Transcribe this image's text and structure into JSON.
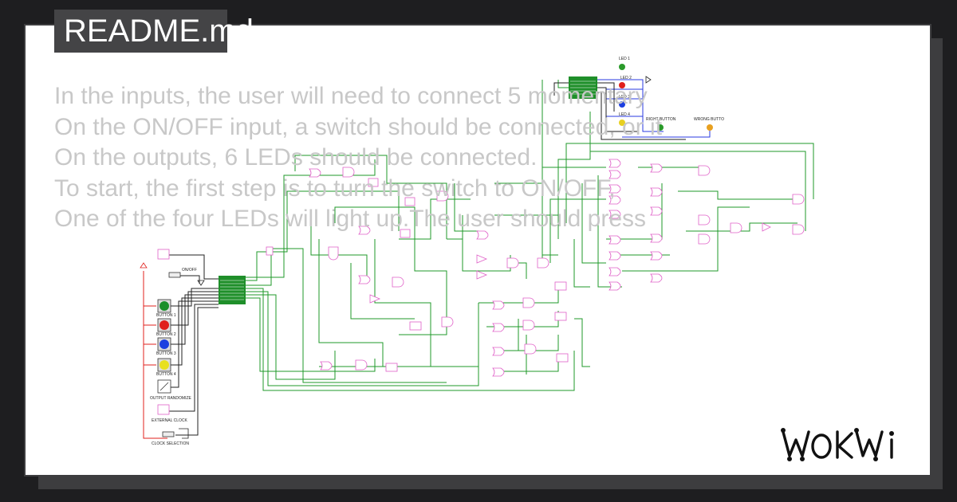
{
  "file_tab": {
    "title": "README.md"
  },
  "description": {
    "lines": [
      "In the inputs, the user will need to connect 5 momentary",
      "On the ON/OFF input, a switch should be connected, or it",
      "On the outputs, 6 LEDs should be connected.",
      "To start, the first step is to turn the switch to ON/OFF,",
      "One of the four LEDs will light up.The user should press"
    ]
  },
  "inputs": {
    "onoff_label": "ON/OFF",
    "buttons": [
      {
        "label": "BUTTON 1",
        "color": "#1a8f2a"
      },
      {
        "label": "BUTTON 2",
        "color": "#e0201c"
      },
      {
        "label": "BUTTON 3",
        "color": "#1c3fe0"
      },
      {
        "label": "BUTTON 4",
        "color": "#e8e020"
      }
    ],
    "randomize_label": "OUTPUT RANDOMIZE",
    "clock_label": "EXTERNAL CLOCK",
    "clock_selection_label": "CLOCK SELECTION"
  },
  "outputs": {
    "leds": [
      {
        "label": "LED 1",
        "color": "#2a9a2a"
      },
      {
        "label": "LED 2",
        "color": "#e0201c"
      },
      {
        "label": "LED 3",
        "color": "#1c3fe0"
      },
      {
        "label": "LED 4",
        "color": "#e8d020"
      }
    ],
    "right_button_label": "RIGHT BUTTON",
    "wrong_button_label": "WRONG BUTTO"
  },
  "colors": {
    "wire_green": "#1f9a2a",
    "wire_red": "#e0201c",
    "wire_blue": "#2a3ae0",
    "wire_black": "#222222",
    "gate": "#e060c8",
    "chip": "#1f8f2a"
  },
  "brand": {
    "logo_text": "WOKWi"
  }
}
